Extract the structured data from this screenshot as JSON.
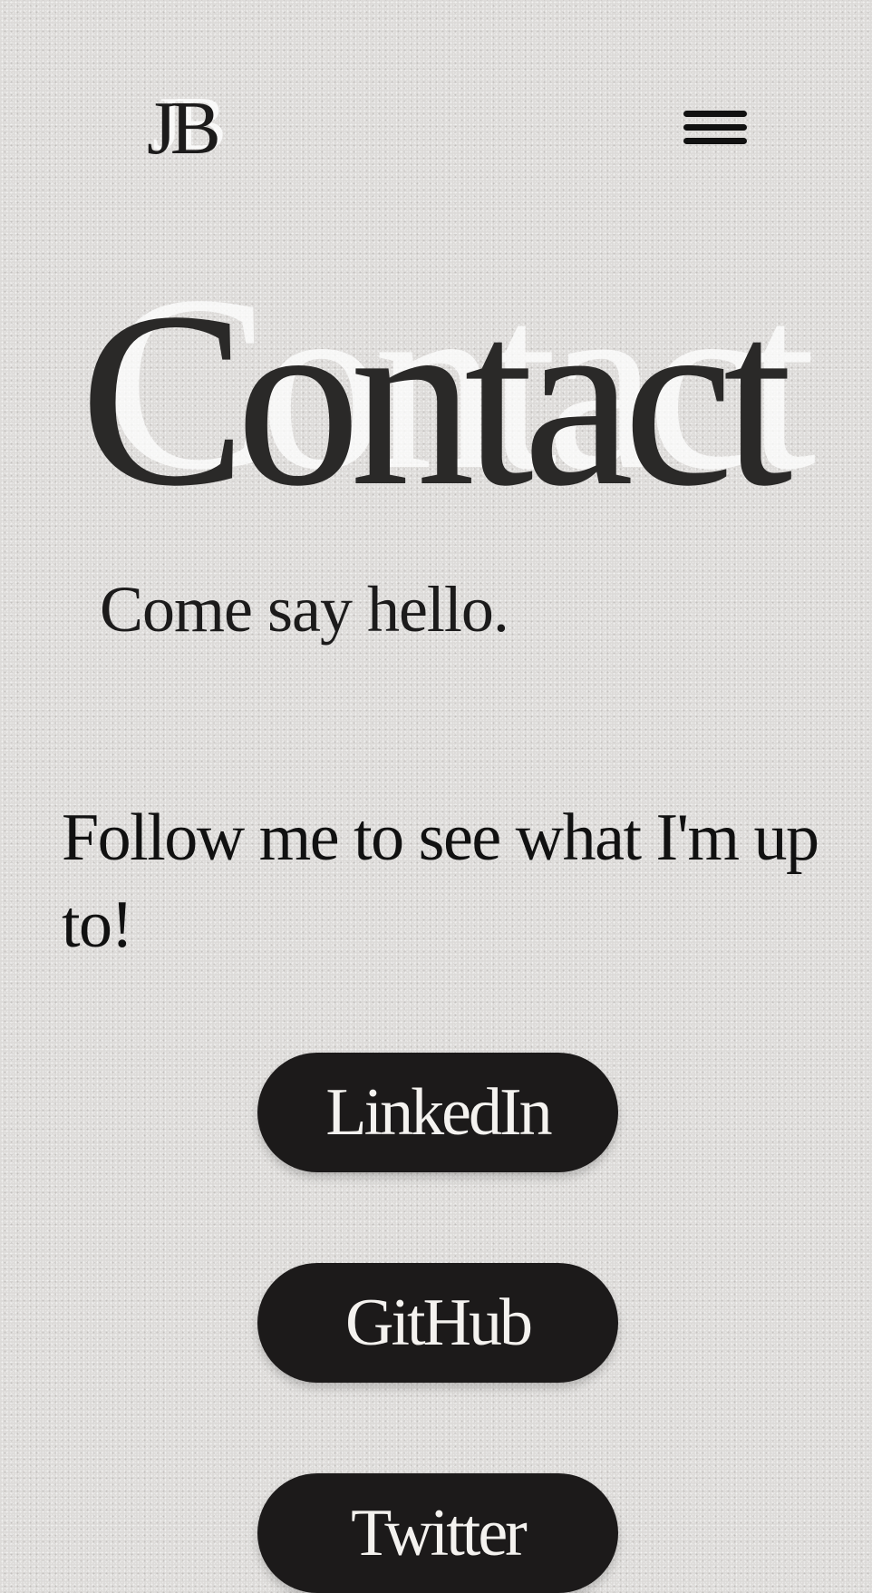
{
  "header": {
    "logo_text": "JB",
    "menu_icon": "hamburger-menu-icon"
  },
  "main": {
    "title": "Contact",
    "subtitle": "Come say hello.",
    "follow_text": "Follow me to see what I'm up to!"
  },
  "social_links": [
    {
      "label": "LinkedIn"
    },
    {
      "label": "GitHub"
    },
    {
      "label": "Twitter"
    }
  ],
  "colors": {
    "background": "#dcdad8",
    "text": "#1c1b1b",
    "button_background": "#1c1a1a",
    "button_text": "#f4f2ef"
  }
}
